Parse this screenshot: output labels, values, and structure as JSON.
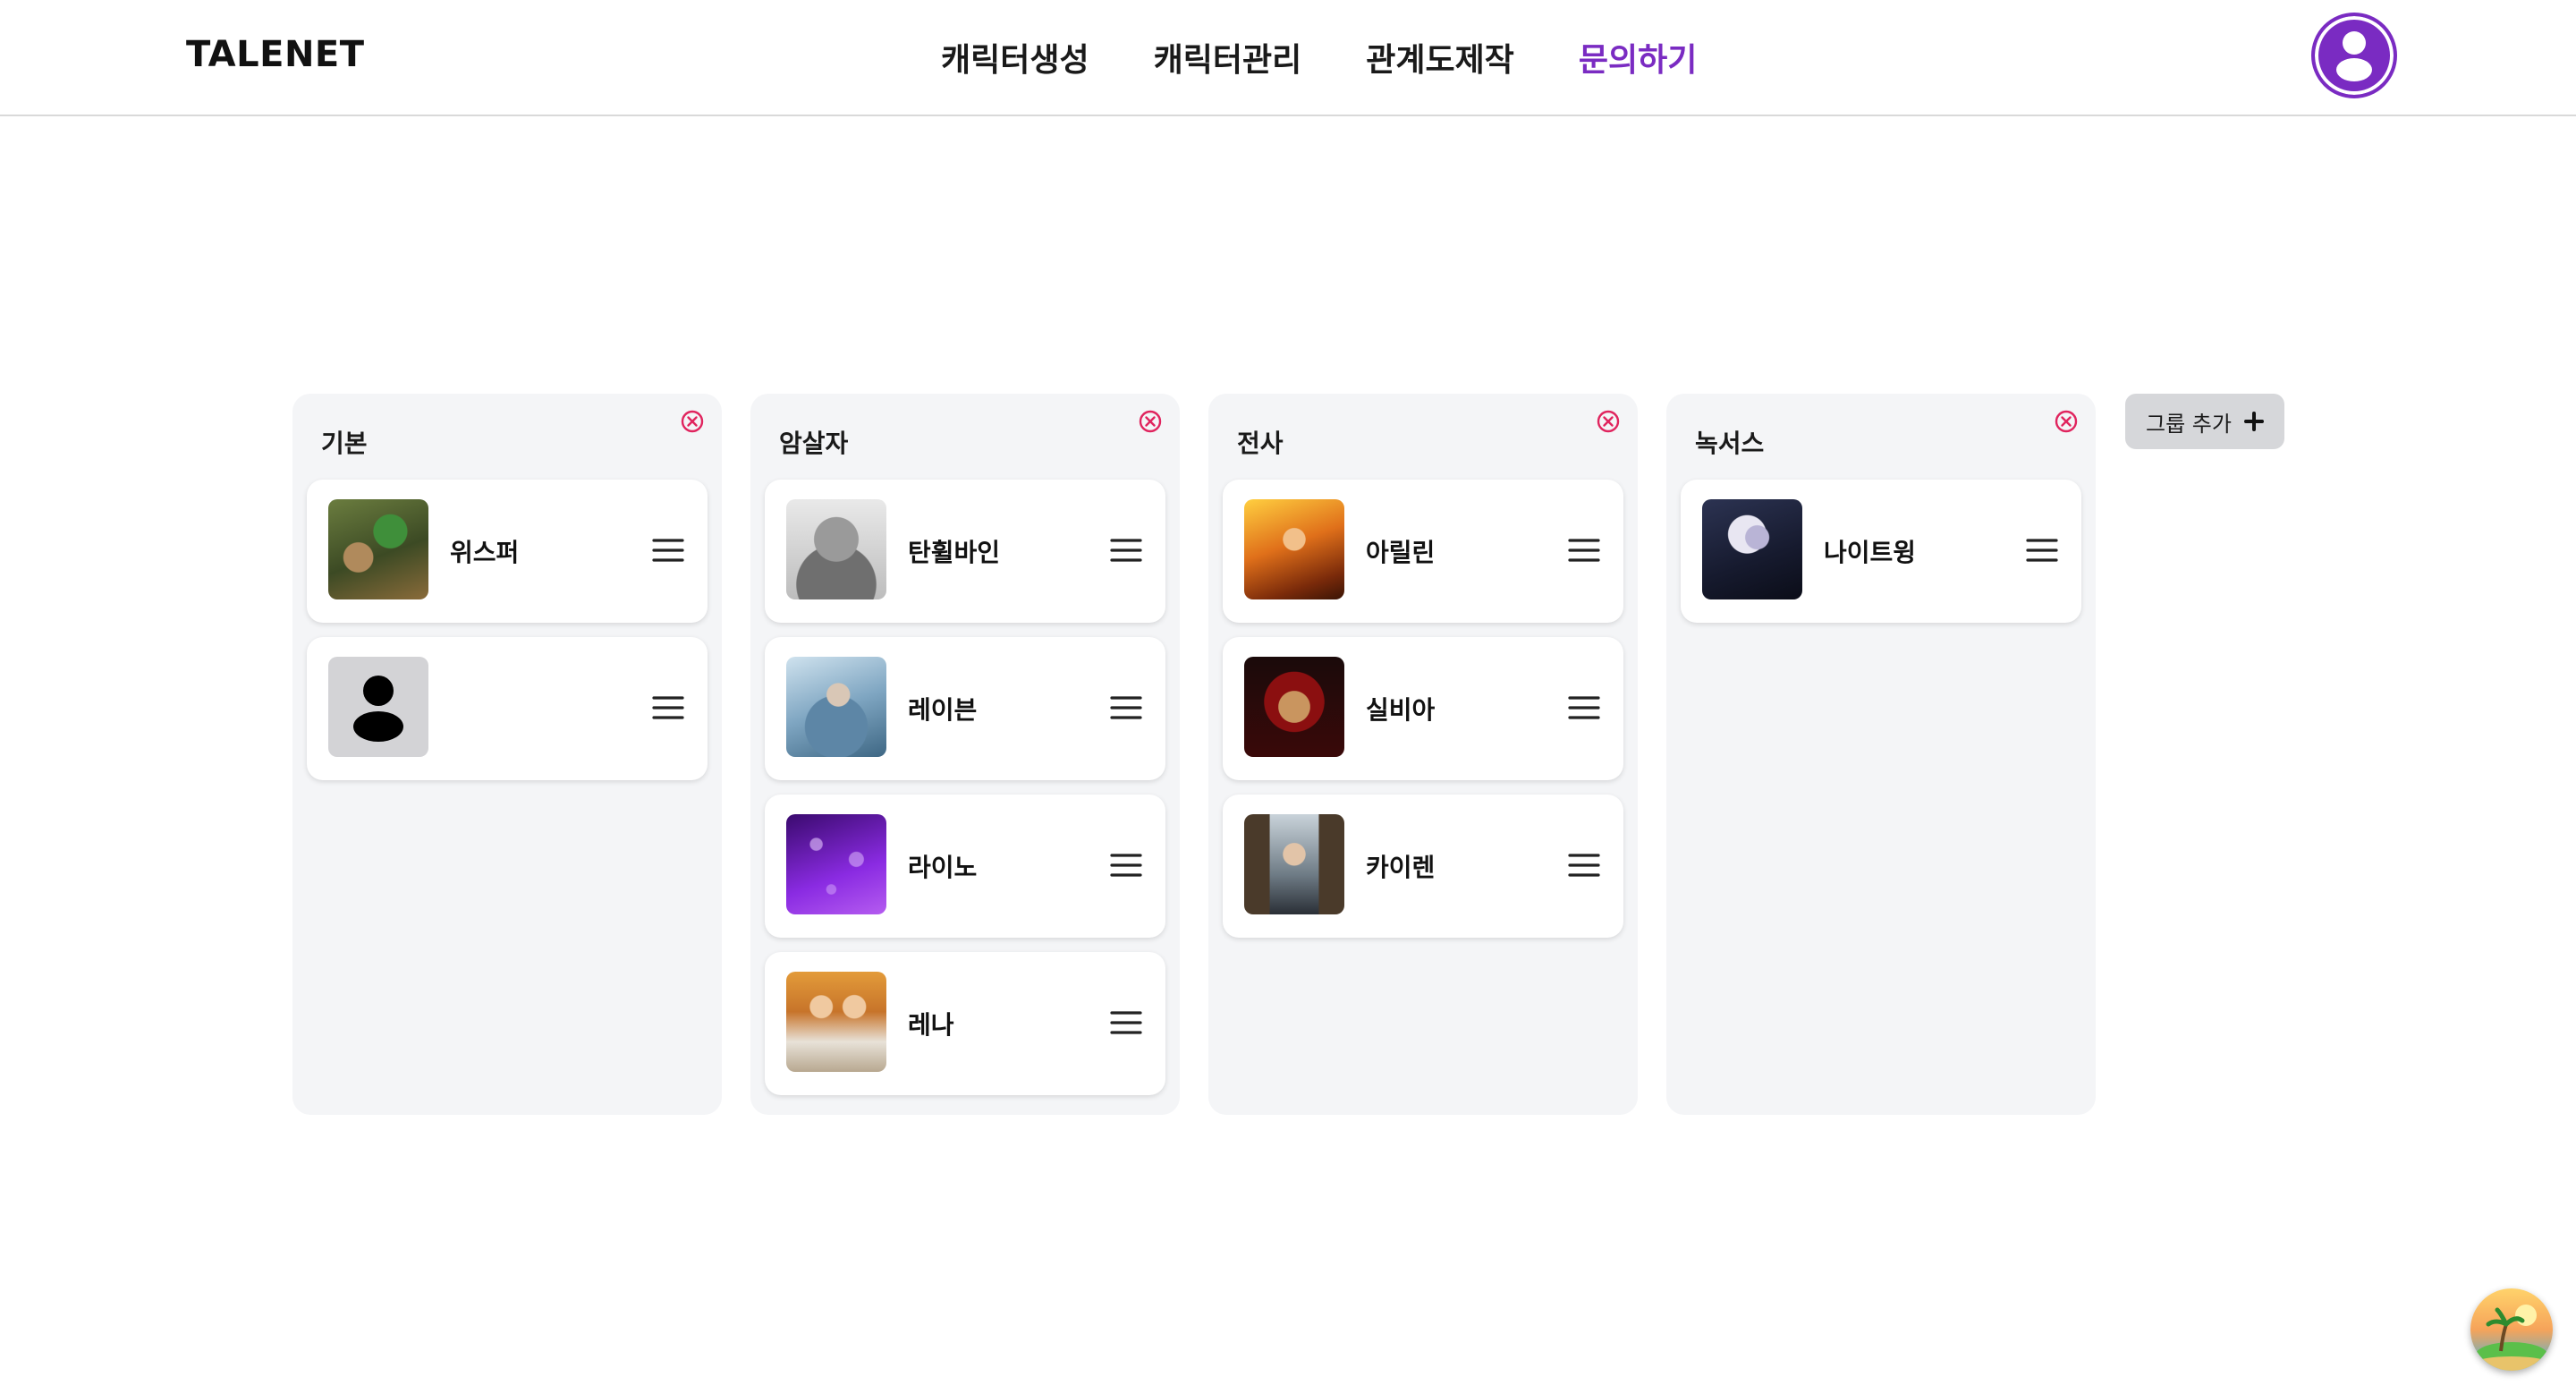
{
  "brand": "TALENET",
  "nav": [
    "캐릭터생성",
    "캐릭터관리",
    "관계도제작",
    "문의하기"
  ],
  "nav_active_index": 3,
  "accent_color": "#7a2bc2",
  "groups": [
    {
      "title": "기본",
      "cards": [
        {
          "name": "위스퍼",
          "thumb": "green-haired-elf"
        },
        {
          "name": "",
          "thumb": "default-person-icon"
        }
      ]
    },
    {
      "title": "암살자",
      "cards": [
        {
          "name": "탄휠바인",
          "thumb": "stone-golem"
        },
        {
          "name": "레이븐",
          "thumb": "blue-mage"
        },
        {
          "name": "라이노",
          "thumb": "purple-bokeh"
        },
        {
          "name": "레나",
          "thumb": "blonde-twins"
        }
      ]
    },
    {
      "title": "전사",
      "cards": [
        {
          "name": "아릴린",
          "thumb": "fire-warrior"
        },
        {
          "name": "실비아",
          "thumb": "red-hooded-man"
        },
        {
          "name": "카이렌",
          "thumb": "long-haired-swordsman"
        }
      ]
    },
    {
      "title": "녹서스",
      "cards": [
        {
          "name": "나이트윙",
          "thumb": "dark-elf"
        }
      ]
    }
  ],
  "add_group_label": "그룹 추가",
  "icons": {
    "group_remove": "close-circle-icon",
    "card_menu": "hamburger-menu-icon",
    "avatar": "user-icon",
    "add": "plus-icon",
    "fab": "beach-avatar"
  }
}
